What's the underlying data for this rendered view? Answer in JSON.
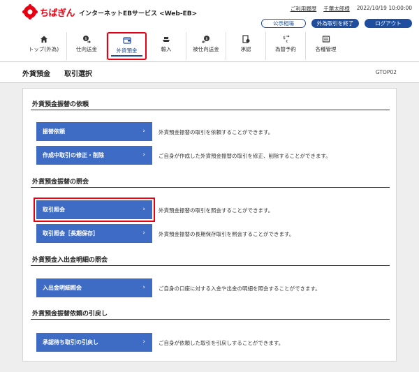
{
  "header": {
    "logo_text": "ちばぎん",
    "service_name": "インターネットEBサービス <Web-EB>",
    "help_link": "ご利用履歴",
    "user_name": "千葉太郎様",
    "datetime": "2022/10/19 10:00:00",
    "rate_button": "公示相場",
    "end_fx_button": "外為取引を終了",
    "logout_button": "ログアウト"
  },
  "nav": [
    {
      "label": "トップ(外為)",
      "icon": "home-icon"
    },
    {
      "label": "仕向送金",
      "icon": "send-money-icon"
    },
    {
      "label": "外貨預金",
      "icon": "deposit-icon",
      "active": true
    },
    {
      "label": "輸入",
      "icon": "import-ship-icon"
    },
    {
      "label": "被仕向送金",
      "icon": "receive-money-icon"
    },
    {
      "label": "承認",
      "icon": "approve-icon"
    },
    {
      "label": "為替予約",
      "icon": "exchange-icon"
    },
    {
      "label": "各種管理",
      "icon": "manage-icon"
    }
  ],
  "title_bar": {
    "title": "外貨預金",
    "subtitle": "取引選択",
    "screen_id": "GTOP02"
  },
  "sections": [
    {
      "title": "外貨預金振替の依頼",
      "items": [
        {
          "label": "振替依頼",
          "desc": "外貨預金振替の取引を依頼することができます。"
        },
        {
          "label": "作成中取引の修正・削除",
          "desc": "ご自身が作成した外貨預金振替の取引を修正、削除することができます。"
        }
      ]
    },
    {
      "title": "外貨預金振替の照会",
      "items": [
        {
          "label": "取引照会",
          "desc": "外貨預金振替の取引を照会することができます。"
        },
        {
          "label": "取引照会［長期保存］",
          "desc": "外貨預金振替の長期保存取引を照会することができます。"
        }
      ]
    },
    {
      "title": "外貨預金入出金明細の照会",
      "items": [
        {
          "label": "入出金明細照会",
          "desc": "ご自身の口座に対する入金や出金の明細を照会することができます。"
        }
      ]
    },
    {
      "title": "外貨預金振替依頼の引戻し",
      "items": [
        {
          "label": "承認待ち取引の引戻し",
          "desc": "ご自身が依頼した取引を引戻しすることができます。"
        }
      ]
    }
  ],
  "chevron": "›",
  "colors": {
    "brand_red": "#e60012",
    "primary_blue": "#3e6cc5",
    "dark_blue": "#1f4e9e"
  }
}
